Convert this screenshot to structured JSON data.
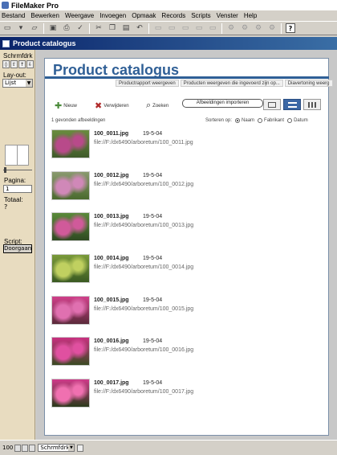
{
  "app": {
    "title": "FileMaker Pro"
  },
  "menu": [
    "Bestand",
    "Bewerken",
    "Weergave",
    "Invoegen",
    "Opmaak",
    "Records",
    "Scripts",
    "Venster",
    "Help"
  ],
  "document": {
    "title": "Product catalogus"
  },
  "status": {
    "mode": "Schrmfdrk",
    "layout_label": "Lay-out:",
    "layout_value": "Lijst",
    "page_label": "Pagina:",
    "page_value": "1",
    "total_label": "Totaal:",
    "total_value": "?",
    "script_label": "Script:",
    "continue_label": "Doorgaan"
  },
  "sheet": {
    "title": "Product catalogus",
    "tabs": [
      "Productrapport weergeven",
      "Producten weergeven die ingevoerd zijn op...",
      "Diavertoning weerg"
    ],
    "actions": {
      "new": "Nieuw",
      "delete": "Verwijderen",
      "find": "Zoeken"
    },
    "import_label": "Afbeeldingen importeren",
    "count_text": "1 gevonden afbeeldingen",
    "sort_label": "Sorteren op:",
    "sort_options": [
      "Naam",
      "Fabrikant",
      "Datum"
    ],
    "sort_selected": "Naam"
  },
  "records": [
    {
      "name": "100_0011.jpg",
      "date": "19-5-04",
      "path": "file://F:/dx6490/arboretum/100_0011.jpg",
      "colors": [
        "#6a8c3f",
        "#b84a8a",
        "#3f5a2a"
      ]
    },
    {
      "name": "100_0012.jpg",
      "date": "19-5-04",
      "path": "file://F:/dx6490/arboretum/100_0012.jpg",
      "colors": [
        "#8a9a6f",
        "#d088b8",
        "#4a6a2e"
      ]
    },
    {
      "name": "100_0013.jpg",
      "date": "19-5-04",
      "path": "file://F:/dx6490/arboretum/100_0013.jpg",
      "colors": [
        "#5a8a3a",
        "#d05a9a",
        "#2f4a22"
      ]
    },
    {
      "name": "100_0014.jpg",
      "date": "19-5-04",
      "path": "file://F:/dx6490/arboretum/100_0014.jpg",
      "colors": [
        "#7a9a3a",
        "#c0d060",
        "#3a5a22"
      ]
    },
    {
      "name": "100_0015.jpg",
      "date": "19-5-04",
      "path": "file://F:/dx6490/arboretum/100_0015.jpg",
      "colors": [
        "#d0408a",
        "#e070b0",
        "#5a2a3a"
      ]
    },
    {
      "name": "100_0016.jpg",
      "date": "19-5-04",
      "path": "file://F:/dx6490/arboretum/100_0016.jpg",
      "colors": [
        "#c83080",
        "#e050a0",
        "#3a4a22"
      ]
    },
    {
      "name": "100_0017.jpg",
      "date": "19-5-04",
      "path": "file://F:/dx6490/arboretum/100_0017.jpg",
      "colors": [
        "#d03a8a",
        "#f070b0",
        "#2a3a1a"
      ]
    }
  ],
  "bottom": {
    "zoom": "100",
    "mode": "Schrmfdrk"
  }
}
